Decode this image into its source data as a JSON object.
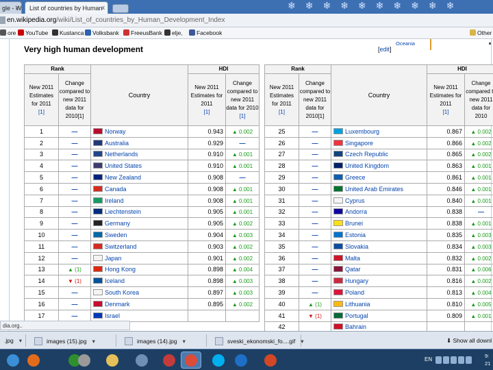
{
  "browser": {
    "tabs": [
      {
        "label": "gle - W "
      },
      {
        "label": "List of countries by Human "
      }
    ],
    "tab_close_glyph": "x",
    "url_host": "en.wikipedia.org",
    "url_path": "/wiki/List_of_countries_by_Human_Development_Index"
  },
  "bookmarks": {
    "items": [
      {
        "label": "ore",
        "color": "#555555"
      },
      {
        "label": "YouTube",
        "color": "#cc0000"
      },
      {
        "label": "Kustanca",
        "color": "#333333"
      },
      {
        "label": "Volksbank",
        "color": "#2d62b0"
      },
      {
        "label": "FreeusBank",
        "color": "#cc3333"
      },
      {
        "label": "elje,",
        "color": "#333333"
      },
      {
        "label": "Facebook",
        "color": "#3b5998"
      }
    ],
    "other_label": "Other"
  },
  "page": {
    "section_title": "Very high human development",
    "edit_open": "[",
    "edit_label": "edit",
    "edit_close": "]",
    "oceania_label": "Oceania"
  },
  "table_headers": {
    "rank": "Rank",
    "hdi": "HDI",
    "country": "Country",
    "new_estimates": [
      "New 2011",
      "Estimates",
      "for 2011",
      "[1]"
    ],
    "rank_change": [
      "Change",
      "compared to",
      "new 2011",
      "data for",
      "2010[1]"
    ],
    "hdi_value": [
      "New 2011",
      "Estimates for",
      "2011",
      "[1]"
    ],
    "hdi_change": [
      "Change",
      "compared to",
      "new 2011",
      "data for 2010",
      "[1]"
    ]
  },
  "table_headers_right": {
    "rank": "Rank",
    "hdi": "HDI",
    "country": "Country",
    "new_estimates": [
      "New 2011",
      "Estimates",
      "for 2011",
      "[1]"
    ],
    "rank_change": [
      "Change",
      "compared to",
      "new 2011",
      "data for",
      "2010[1]"
    ],
    "hdi_value": [
      "New 2011",
      "Estimates for",
      "2011",
      "[1]"
    ],
    "hdi_change": [
      "Change",
      "compared to",
      "new 2011",
      "data for 2010"
    ]
  },
  "rows_left": [
    {
      "rank": "1",
      "rank_change": "—",
      "country": "Norway",
      "hdi": "0.943",
      "hdi_change": "▲ 0.002"
    },
    {
      "rank": "2",
      "rank_change": "—",
      "country": "Australia",
      "hdi": "0.929",
      "hdi_change": "—"
    },
    {
      "rank": "3",
      "rank_change": "—",
      "country": "Netherlands",
      "hdi": "0.910",
      "hdi_change": "▲ 0.001"
    },
    {
      "rank": "4",
      "rank_change": "—",
      "country": "United States",
      "hdi": "0.910",
      "hdi_change": "▲ 0.001"
    },
    {
      "rank": "5",
      "rank_change": "—",
      "country": "New Zealand",
      "hdi": "0.908",
      "hdi_change": "—"
    },
    {
      "rank": "6",
      "rank_change": "—",
      "country": "Canada",
      "hdi": "0.908",
      "hdi_change": "▲ 0.001"
    },
    {
      "rank": "7",
      "rank_change": "—",
      "country": "Ireland",
      "hdi": "0.908",
      "hdi_change": "▲ 0.001"
    },
    {
      "rank": "8",
      "rank_change": "—",
      "country": "Liechtenstein",
      "hdi": "0.905",
      "hdi_change": "▲ 0.001"
    },
    {
      "rank": "9",
      "rank_change": "—",
      "country": "Germany",
      "hdi": "0.905",
      "hdi_change": "▲ 0.002"
    },
    {
      "rank": "10",
      "rank_change": "—",
      "country": "Sweden",
      "hdi": "0.904",
      "hdi_change": "▲ 0.003"
    },
    {
      "rank": "11",
      "rank_change": "—",
      "country": "Switzerland",
      "hdi": "0.903",
      "hdi_change": "▲ 0.002"
    },
    {
      "rank": "12",
      "rank_change": "—",
      "country": "Japan",
      "hdi": "0.901",
      "hdi_change": "▲ 0.002"
    },
    {
      "rank": "13",
      "rank_change": "▲ (1)",
      "country": "Hong Kong",
      "hdi": "0.898",
      "hdi_change": "▲ 0.004"
    },
    {
      "rank": "14",
      "rank_change": "▼ (1)",
      "country": "Iceland",
      "hdi": "0.898",
      "hdi_change": "▲ 0.003"
    },
    {
      "rank": "15",
      "rank_change": "—",
      "country": "South Korea",
      "hdi": "0.897",
      "hdi_change": "▲ 0.003"
    },
    {
      "rank": "16",
      "rank_change": "—",
      "country": "Denmark",
      "hdi": "0.895",
      "hdi_change": "▲ 0.002"
    },
    {
      "rank": "17",
      "rank_change": "—",
      "country": "Israel",
      "hdi": "",
      "hdi_change": ""
    }
  ],
  "rows_right": [
    {
      "rank": "25",
      "rank_change": "—",
      "country": "Luxembourg",
      "hdi": "0.867",
      "hdi_change": "▲ 0.002"
    },
    {
      "rank": "26",
      "rank_change": "—",
      "country": "Singapore",
      "hdi": "0.866",
      "hdi_change": "▲ 0.002"
    },
    {
      "rank": "27",
      "rank_change": "—",
      "country": "Czech Republic",
      "hdi": "0.865",
      "hdi_change": "▲ 0.002"
    },
    {
      "rank": "28",
      "rank_change": "—",
      "country": "United Kingdom",
      "hdi": "0.863",
      "hdi_change": "▲ 0.001"
    },
    {
      "rank": "29",
      "rank_change": "—",
      "country": "Greece",
      "hdi": "0.861",
      "hdi_change": "▲ 0.001"
    },
    {
      "rank": "30",
      "rank_change": "—",
      "country": "United Arab Emirates",
      "hdi": "0.846",
      "hdi_change": "▲ 0.001"
    },
    {
      "rank": "31",
      "rank_change": "—",
      "country": "Cyprus",
      "hdi": "0.840",
      "hdi_change": "▲ 0.001"
    },
    {
      "rank": "32",
      "rank_change": "—",
      "country": "Andorra",
      "hdi": "0.838",
      "hdi_change": "—"
    },
    {
      "rank": "33",
      "rank_change": "—",
      "country": "Brunei",
      "hdi": "0.838",
      "hdi_change": "▲ 0.001"
    },
    {
      "rank": "34",
      "rank_change": "—",
      "country": "Estonia",
      "hdi": "0.835",
      "hdi_change": "▲ 0.003"
    },
    {
      "rank": "35",
      "rank_change": "—",
      "country": "Slovakia",
      "hdi": "0.834",
      "hdi_change": "▲ 0.003"
    },
    {
      "rank": "36",
      "rank_change": "—",
      "country": "Malta",
      "hdi": "0.832",
      "hdi_change": "▲ 0.002"
    },
    {
      "rank": "37",
      "rank_change": "—",
      "country": "Qatar",
      "hdi": "0.831",
      "hdi_change": "▲ 0.006"
    },
    {
      "rank": "38",
      "rank_change": "—",
      "country": "Hungary",
      "hdi": "0.816",
      "hdi_change": "▲ 0.002"
    },
    {
      "rank": "39",
      "rank_change": "—",
      "country": "Poland",
      "hdi": "0.813",
      "hdi_change": "▲ 0.004"
    },
    {
      "rank": "40",
      "rank_change": "▲ (1)",
      "country": "Lithuania",
      "hdi": "0.810",
      "hdi_change": "▲ 0.005"
    },
    {
      "rank": "41",
      "rank_change": "▼ (1)",
      "country": "Portugal",
      "hdi": "0.809",
      "hdi_change": "▲ 0.001"
    },
    {
      "rank": "42",
      "rank_change": "",
      "country": "Bahrain",
      "hdi": "",
      "hdi_change": ""
    }
  ],
  "flag_colors": {
    "Norway": "#ba0c2f",
    "Australia": "#1f3a7a",
    "Netherlands": "#21468b",
    "United States": "#3c3b6e",
    "New Zealand": "#00247d",
    "Canada": "#d52b1e",
    "Ireland": "#169b62",
    "Liechtenstein": "#002b7f",
    "Germany": "#222222",
    "Sweden": "#006aa7",
    "Switzerland": "#d52b1e",
    "Japan": "#f4f4f4",
    "Hong Kong": "#de2910",
    "Iceland": "#02529c",
    "South Korea": "#f4f4f4",
    "Denmark": "#c60c30",
    "Israel": "#0038b8",
    "Luxembourg": "#00a1de",
    "Singapore": "#ef3340",
    "Czech Republic": "#11457e",
    "United Kingdom": "#012169",
    "Greece": "#0d5eaf",
    "United Arab Emirates": "#00732f",
    "Cyprus": "#f4f4f4",
    "Andorra": "#10069f",
    "Brunei": "#f7e017",
    "Estonia": "#0072ce",
    "Slovakia": "#0b4ea2",
    "Malta": "#cf142b",
    "Qatar": "#8a1538",
    "Hungary": "#cd2a3e",
    "Poland": "#dc143c",
    "Lithuania": "#fdb913",
    "Portugal": "#046a38",
    "Bahrain": "#ce1126"
  },
  "status_bar": {
    "url": "dia.org.."
  },
  "downloads": {
    "items": [
      {
        "name": ".jpg"
      },
      {
        "name": "images (15).jpg"
      },
      {
        "name": "images (14).jpg"
      },
      {
        "name": "sveski_ekonomski_fo....gif"
      }
    ],
    "show_all": "Show all downl"
  },
  "taskbar": {
    "lang": "EN",
    "clock": [
      "9:",
      "21"
    ],
    "icons": [
      {
        "name": "start",
        "color": "#3a8fd6"
      },
      {
        "name": "firefox",
        "color": "#e36c1c"
      },
      {
        "name": "utorrent",
        "color": "#2f8f2f"
      },
      {
        "name": "media",
        "color": "#9a9a9a"
      },
      {
        "name": "folder",
        "color": "#e5c05a"
      },
      {
        "name": "email",
        "color": "#6f8fb5"
      },
      {
        "name": "paint",
        "color": "#c43b3b"
      },
      {
        "name": "chrome",
        "color": "#dd4b39"
      },
      {
        "name": "skype",
        "color": "#00aff0"
      },
      {
        "name": "internet-explorer",
        "color": "#1e6fc8"
      },
      {
        "name": "powerpoint",
        "color": "#d24726"
      }
    ]
  }
}
